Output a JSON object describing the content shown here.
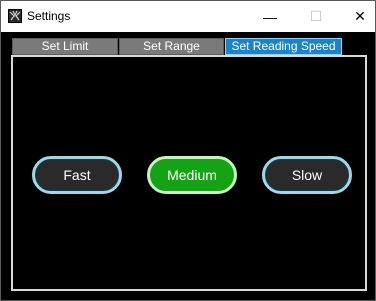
{
  "window": {
    "title": "Settings",
    "controls": {
      "minimize": "—",
      "maximize": "☐",
      "close": "✕"
    }
  },
  "tabs": [
    {
      "label": "Set Limit",
      "active": false
    },
    {
      "label": "Set Range",
      "active": false
    },
    {
      "label": "Set Reading Speed",
      "active": true
    }
  ],
  "speed_options": [
    {
      "label": "Fast",
      "selected": false
    },
    {
      "label": "Medium",
      "selected": true
    },
    {
      "label": "Slow",
      "selected": false
    }
  ],
  "colors": {
    "active_tab": "#1a84c7",
    "selected_button": "#14a314",
    "button_ring": "#9fd7e6",
    "background": "#000000"
  }
}
